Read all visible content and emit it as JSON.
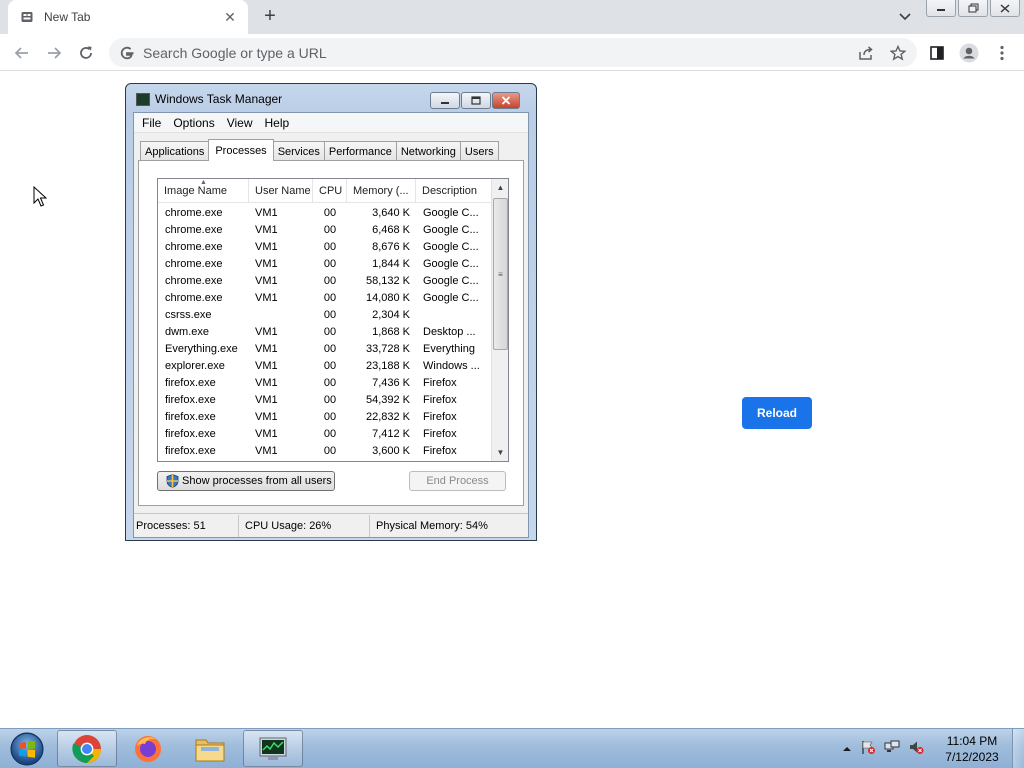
{
  "browser": {
    "tab_title": "New Tab",
    "omnibox_placeholder": "Search Google or type a URL"
  },
  "page": {
    "reload_label": "Reload"
  },
  "task_manager": {
    "title": "Windows Task Manager",
    "menu": [
      "File",
      "Options",
      "View",
      "Help"
    ],
    "tabs": [
      "Applications",
      "Processes",
      "Services",
      "Performance",
      "Networking",
      "Users"
    ],
    "active_tab": "Processes",
    "columns": [
      "Image Name",
      "User Name",
      "CPU",
      "Memory (...",
      "Description"
    ],
    "rows": [
      {
        "name": "chrome.exe",
        "user": "VM1",
        "cpu": "00",
        "mem": "3,640 K",
        "desc": "Google C..."
      },
      {
        "name": "chrome.exe",
        "user": "VM1",
        "cpu": "00",
        "mem": "6,468 K",
        "desc": "Google C..."
      },
      {
        "name": "chrome.exe",
        "user": "VM1",
        "cpu": "00",
        "mem": "8,676 K",
        "desc": "Google C..."
      },
      {
        "name": "chrome.exe",
        "user": "VM1",
        "cpu": "00",
        "mem": "1,844 K",
        "desc": "Google C..."
      },
      {
        "name": "chrome.exe",
        "user": "VM1",
        "cpu": "00",
        "mem": "58,132 K",
        "desc": "Google C..."
      },
      {
        "name": "chrome.exe",
        "user": "VM1",
        "cpu": "00",
        "mem": "14,080 K",
        "desc": "Google C..."
      },
      {
        "name": "csrss.exe",
        "user": "",
        "cpu": "00",
        "mem": "2,304 K",
        "desc": ""
      },
      {
        "name": "dwm.exe",
        "user": "VM1",
        "cpu": "00",
        "mem": "1,868 K",
        "desc": "Desktop ..."
      },
      {
        "name": "Everything.exe",
        "user": "VM1",
        "cpu": "00",
        "mem": "33,728 K",
        "desc": "Everything"
      },
      {
        "name": "explorer.exe",
        "user": "VM1",
        "cpu": "00",
        "mem": "23,188 K",
        "desc": "Windows ..."
      },
      {
        "name": "firefox.exe",
        "user": "VM1",
        "cpu": "00",
        "mem": "7,436 K",
        "desc": "Firefox"
      },
      {
        "name": "firefox.exe",
        "user": "VM1",
        "cpu": "00",
        "mem": "54,392 K",
        "desc": "Firefox"
      },
      {
        "name": "firefox.exe",
        "user": "VM1",
        "cpu": "00",
        "mem": "22,832 K",
        "desc": "Firefox"
      },
      {
        "name": "firefox.exe",
        "user": "VM1",
        "cpu": "00",
        "mem": "7,412 K",
        "desc": "Firefox"
      },
      {
        "name": "firefox.exe",
        "user": "VM1",
        "cpu": "00",
        "mem": "3,600 K",
        "desc": "Firefox"
      }
    ],
    "show_all_label": "Show processes from all users",
    "end_process_label": "End Process",
    "status": {
      "processes": "Processes: 51",
      "cpu": "CPU Usage: 26%",
      "memory": "Physical Memory: 54%"
    }
  },
  "taskbar": {
    "apps": [
      "chrome-icon",
      "firefox-icon",
      "folder-icon",
      "task-manager-icon"
    ],
    "time": "11:04 PM",
    "date": "7/12/2023"
  },
  "colors": {
    "accent": "#1a73e8",
    "taskbar": "#9fbcdb",
    "window_frame": "#b9cde6"
  }
}
